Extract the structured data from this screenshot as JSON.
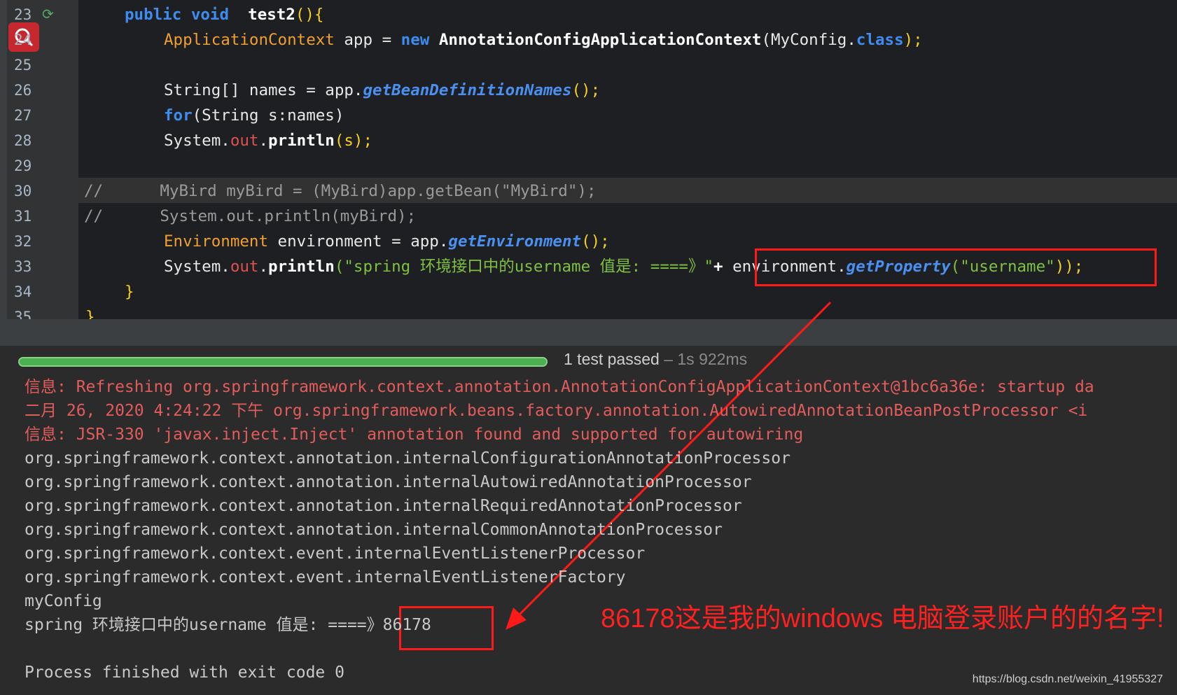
{
  "editor": {
    "line_numbers": [
      "23",
      "24",
      "25",
      "26",
      "27",
      "28",
      "29",
      "30",
      "31",
      "32",
      "33",
      "34",
      "35"
    ],
    "lines": {
      "l23": {
        "kw1": "public",
        "kw2": "void",
        "name": "test2",
        "paren": "(){"
      },
      "l24": {
        "type": "ApplicationContext",
        "var": " app = ",
        "kw": "new",
        "cls": "AnnotationConfigApplicationContext",
        "arg": "(MyConfig.",
        "kw2": "class",
        "end": ");"
      },
      "l26": {
        "a": "String[] names = app.",
        "method": "getBeanDefinitionNames",
        "end": "();"
      },
      "l27": {
        "kw": "for",
        "rest": "(String s:names)"
      },
      "l28": {
        "a": "System.",
        "field": "out",
        "b": ".",
        "method": "println",
        "end": "(s);"
      },
      "l30": {
        "text": "//      MyBird myBird = (MyBird)app.getBean(\"MyBird\");"
      },
      "l31": {
        "text": "//      System.out.println(myBird);"
      },
      "l32": {
        "type": "Environment",
        "var": " environment = app.",
        "method": "getEnvironment",
        "end": "();"
      },
      "l33": {
        "a": "System.",
        "field": "out",
        "b": ".",
        "method": "println",
        "str": "(\"spring 环境接口中的username 值是: ====》\"",
        "plus": "+ ",
        "obj": "environment.",
        "method2": "getProperty",
        "str2": "(\"username\"",
        "end": "));"
      },
      "l34": {
        "brace": "}"
      },
      "l35": {
        "brace": "}"
      }
    }
  },
  "test_status": {
    "passed": "1 test passed",
    "time": " – 1s 922ms"
  },
  "progress": {
    "percent": 100
  },
  "console": {
    "lines": [
      {
        "text": "信息: Refreshing org.springframework.context.annotation.AnnotationConfigApplicationContext@1bc6a36e: startup da",
        "err": true
      },
      {
        "text": "二月 26, 2020 4:24:22 下午 org.springframework.beans.factory.annotation.AutowiredAnnotationBeanPostProcessor <i",
        "err": true
      },
      {
        "text": "信息: JSR-330 'javax.inject.Inject' annotation found and supported for autowiring",
        "err": true
      },
      {
        "text": "org.springframework.context.annotation.internalConfigurationAnnotationProcessor",
        "err": false
      },
      {
        "text": "org.springframework.context.annotation.internalAutowiredAnnotationProcessor",
        "err": false
      },
      {
        "text": "org.springframework.context.annotation.internalRequiredAnnotationProcessor",
        "err": false
      },
      {
        "text": "org.springframework.context.annotation.internalCommonAnnotationProcessor",
        "err": false
      },
      {
        "text": "org.springframework.context.event.internalEventListenerProcessor",
        "err": false
      },
      {
        "text": "org.springframework.context.event.internalEventListenerFactory",
        "err": false
      },
      {
        "text": "myConfig",
        "err": false
      },
      {
        "text": "spring 环境接口中的username 值是: ====》86178",
        "err": false
      },
      {
        "text": "",
        "err": false
      },
      {
        "text": "Process finished with exit code 0",
        "err": false
      }
    ]
  },
  "annotation": {
    "text": "86178这是我的windows 电脑登录账户的的名字!"
  },
  "watermark": {
    "text": "https://blog.csdn.net/weixin_41955327"
  },
  "colors": {
    "annotation_red": "#ff1a1a",
    "progress_green": "#4caf50"
  }
}
